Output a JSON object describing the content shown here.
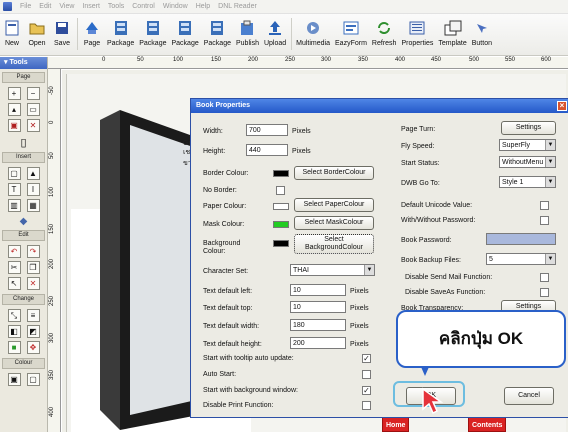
{
  "menubar": [
    "File",
    "Edit",
    "View",
    "Insert",
    "Tools",
    "Control",
    "Window",
    "Help",
    "DNL Reader"
  ],
  "toolbar": [
    {
      "label": "New",
      "icon": "new-doc-icon"
    },
    {
      "label": "Open",
      "icon": "open-folder-icon"
    },
    {
      "label": "Save",
      "icon": "save-disk-icon"
    },
    {
      "label": "Page",
      "icon": "page-icon"
    },
    {
      "label": "Package",
      "icon": "package-icon"
    },
    {
      "label": "Package",
      "icon": "package-icon"
    },
    {
      "label": "Package",
      "icon": "package-icon"
    },
    {
      "label": "Package",
      "icon": "package-icon"
    },
    {
      "label": "Publish",
      "icon": "publish-icon"
    },
    {
      "label": "Upload",
      "icon": "upload-icon"
    },
    {
      "label": "Multimedia",
      "icon": "multimedia-icon"
    },
    {
      "label": "EazyForm",
      "icon": "form-icon"
    },
    {
      "label": "Refresh",
      "icon": "refresh-icon"
    },
    {
      "label": "Properties",
      "icon": "properties-icon"
    },
    {
      "label": "Template",
      "icon": "template-icon"
    },
    {
      "label": "Button",
      "icon": "button-icon"
    }
  ],
  "left_panel": {
    "title": "Tools",
    "sections": [
      "Page",
      "Insert",
      "Edit",
      "Change",
      "Colour"
    ]
  },
  "ruler": {
    "top": [
      "0",
      "50",
      "100",
      "150",
      "200",
      "250",
      "300",
      "350",
      "400",
      "450",
      "500",
      "550",
      "600"
    ],
    "left": [
      "-50",
      "0",
      "50",
      "100",
      "150",
      "200",
      "250",
      "300",
      "350",
      "400"
    ]
  },
  "page": {
    "text_fragments": [
      "Gr",
      "เช",
      "ขา"
    ],
    "buttons": [
      "Home",
      "Contents"
    ]
  },
  "dialog": {
    "title": "Book Properties",
    "width_label": "Width:",
    "width_value": "700",
    "height_label": "Height:",
    "height_value": "440",
    "pixels": "Pixels",
    "border_colour_label": "Border Colour:",
    "border_colour_button": "Select BorderColour",
    "no_border_label": "No Border:",
    "paper_colour_label": "Paper Colour:",
    "paper_colour_button": "Select PaperColour",
    "mask_colour_label": "Mask Colour:",
    "mask_colour_button": "Select MaskColour",
    "background_colour_label": "Background Colour:",
    "background_colour_button": "Select BackgroundColour",
    "character_set_label": "Character Set:",
    "character_set_value": "THAI",
    "text_left_label": "Text default left:",
    "text_left_value": "10",
    "text_top_label": "Text default top:",
    "text_top_value": "10",
    "text_width_label": "Text default width:",
    "text_width_value": "180",
    "text_height_label": "Text default height:",
    "text_height_value": "200",
    "tooltip_label": "Start with tooltip auto update:",
    "auto_start_label": "Auto Start:",
    "bg_window_label": "Start with background window:",
    "disable_print_label": "Disable Print Function:",
    "page_turn_label": "Page Turn:",
    "settings_label": "Settings",
    "fly_speed_label": "Fly Speed:",
    "fly_speed_value": "SuperFly",
    "start_status_label": "Start Status:",
    "start_status_value": "WithoutMenu",
    "dwb_goto_label": "DWB Go To:",
    "dwb_goto_value": "Style 1",
    "default_unicode_label": "Default Unicode Value:",
    "with_without_password_label": "With/Without Password:",
    "book_password_label": "Book Password:",
    "book_backup_label": "Book Backup Files:",
    "book_backup_value": "5",
    "disable_send_mail_label": "Disable Send Mail Function:",
    "disable_saveas_label": "Disable SaveAs Function:",
    "book_transparency_label": "Book Transparency:",
    "ok_label": "OK",
    "cancel_label": "Cancel"
  },
  "callout": {
    "text": "คลิกปุ่ม OK"
  },
  "colors": {
    "border_swatch": "#000000",
    "paper_swatch": "#ffffff",
    "mask_swatch": "#22cc22",
    "background_swatch": "#000000",
    "password_field": "#a9b8dc",
    "title_bar": "#2d5fcb"
  }
}
